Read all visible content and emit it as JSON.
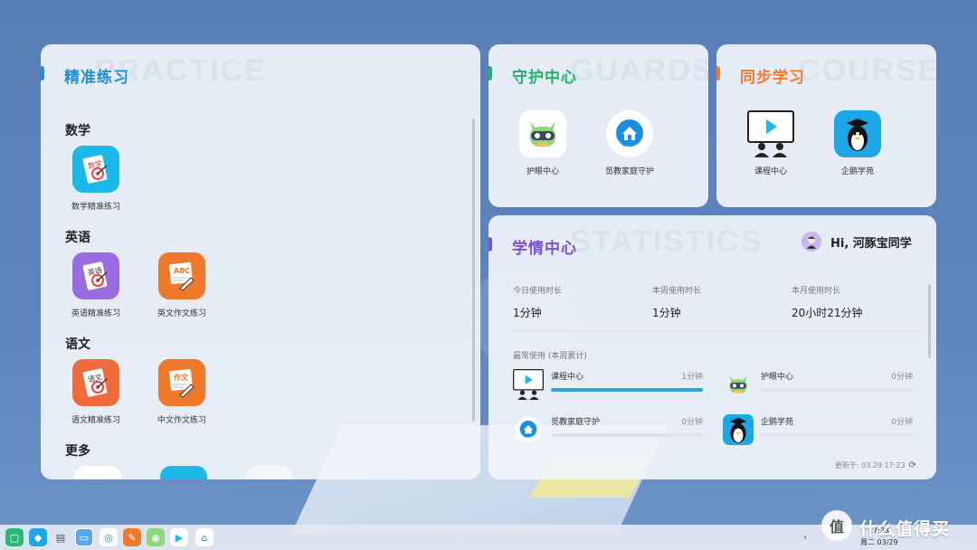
{
  "colors": {
    "practice": "#1f8fd0",
    "guard": "#21b26b",
    "sync": "#f07a2a",
    "study": "#7c4fd6",
    "progress": "#25a8d8"
  },
  "practice": {
    "title": "精准练习",
    "ghost": "PRACTICE",
    "sections": {
      "math": {
        "label": "数学",
        "apps": [
          {
            "label": "数学精准练习",
            "icon": "math-book-icon"
          }
        ]
      },
      "english": {
        "label": "英语",
        "apps": [
          {
            "label": "英语精准练习",
            "icon": "english-book-icon"
          },
          {
            "label": "英文作文练习",
            "icon": "english-writing-icon"
          }
        ]
      },
      "chinese": {
        "label": "语文",
        "apps": [
          {
            "label": "语文精准练习",
            "icon": "chinese-book-icon"
          },
          {
            "label": "中文作文练习",
            "icon": "chinese-writing-icon"
          }
        ]
      },
      "more": {
        "label": "更多"
      }
    }
  },
  "guard": {
    "title": "守护中心",
    "ghost": "GUARDS",
    "apps": [
      {
        "label": "护眼中心",
        "icon": "eye-care-robot-icon"
      },
      {
        "label": "觅教家庭守护",
        "icon": "family-guard-icon"
      }
    ]
  },
  "sync": {
    "title": "同步学习",
    "ghost": "COURSE",
    "apps": [
      {
        "label": "课程中心",
        "icon": "course-center-icon"
      },
      {
        "label": "企鹅学苑",
        "icon": "penguin-academy-icon"
      }
    ]
  },
  "study": {
    "title": "学情中心",
    "ghost": "STATISTICS",
    "greeting": "Hi, 河豚宝同学",
    "stats": [
      {
        "label": "今日使用时长",
        "value": "1分钟"
      },
      {
        "label": "本周使用时长",
        "value": "1分钟"
      },
      {
        "label": "本月使用时长",
        "value": "20小时21分钟"
      }
    ],
    "usage_title": "最常使用 (本周累计)",
    "usage": [
      {
        "name": "课程中心",
        "time": "1分钟",
        "progress": 1.0,
        "icon": "course-center-icon"
      },
      {
        "name": "护眼中心",
        "time": "0分钟",
        "progress": 0.0,
        "icon": "eye-care-robot-icon"
      },
      {
        "name": "觅教家庭守护",
        "time": "0分钟",
        "progress": 0.0,
        "icon": "family-guard-icon"
      },
      {
        "name": "企鹅学苑",
        "time": "0分钟",
        "progress": 0.0,
        "icon": "penguin-academy-icon"
      }
    ],
    "updated": "更新于: 03.29 17:23"
  },
  "taskbar": {
    "time": "17:23",
    "date": "周二 03/29"
  },
  "watermark": {
    "logo": "值",
    "text": "什么值得买"
  }
}
